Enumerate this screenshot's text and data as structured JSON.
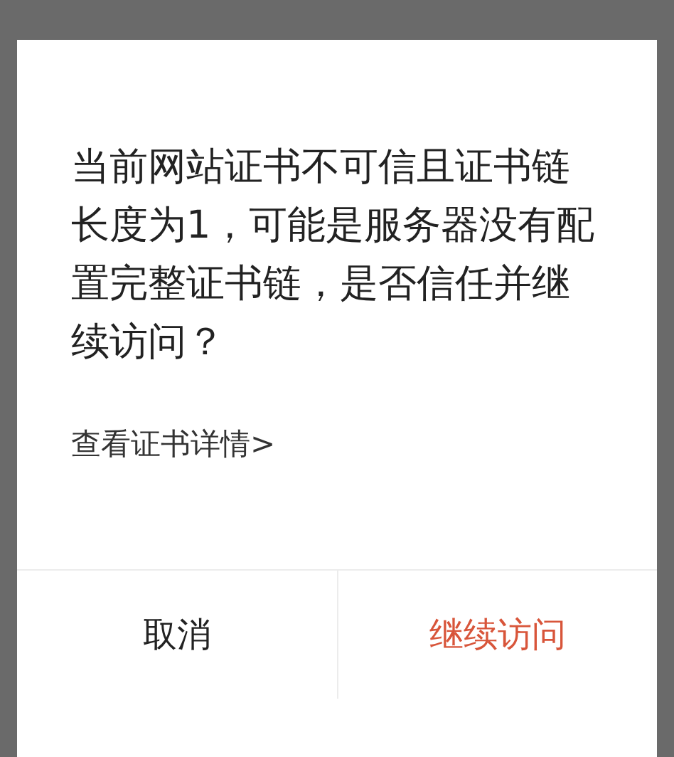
{
  "dialog": {
    "message": "当前网站证书不可信且证书链长度为1，可能是服务器没有配置完整证书链，是否信任并继续访问？",
    "link": "查看证书详情>",
    "buttons": [
      {
        "label": "取消",
        "kind": "cancel"
      },
      {
        "label": "继续访问",
        "kind": "confirm"
      }
    ]
  }
}
